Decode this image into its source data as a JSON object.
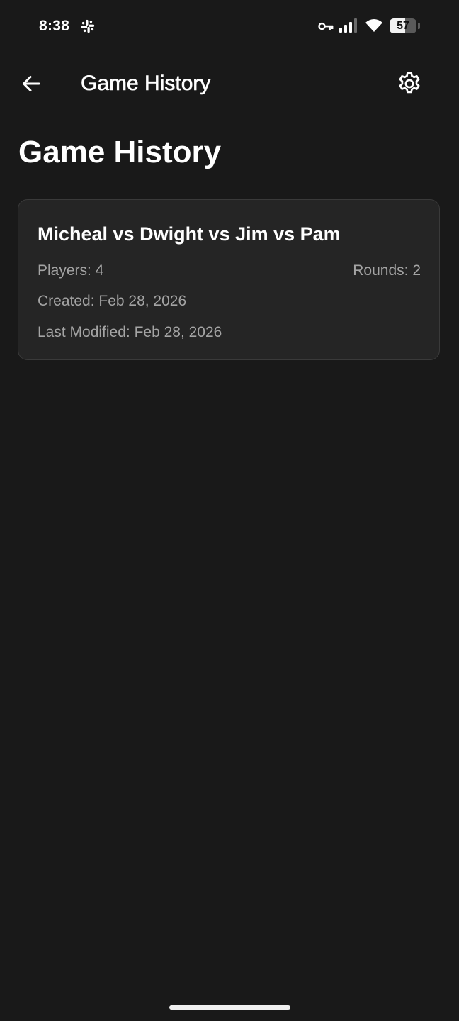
{
  "status_bar": {
    "time": "8:38",
    "battery_level": "57",
    "battery_fraction": 0.57,
    "icons": [
      "slack-icon",
      "key-icon",
      "cell-signal-icon",
      "wifi-icon",
      "battery-icon"
    ]
  },
  "app_bar": {
    "back_icon": "arrow-left-icon",
    "title": "Game History",
    "settings_icon": "gear-icon"
  },
  "page": {
    "title": "Game History"
  },
  "games": [
    {
      "title": "Micheal vs Dwight vs Jim vs Pam",
      "players": "Players: 4",
      "rounds": "Rounds: 2",
      "created": "Created: Feb 28, 2026",
      "last_modified": "Last Modified: Feb 28, 2026"
    }
  ],
  "colors": {
    "background": "#191919",
    "card_background": "#252525",
    "card_border": "#3a3a3a",
    "primary_text": "#ffffff",
    "secondary_text": "#a4a4a4"
  }
}
